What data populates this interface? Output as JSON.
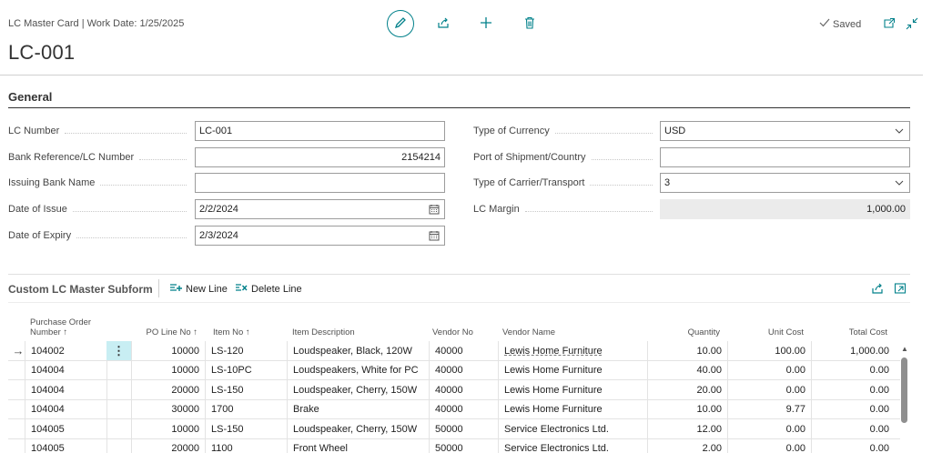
{
  "header": {
    "breadcrumb": "LC Master Card | Work Date: 1/25/2025",
    "record_title": "LC-001",
    "saved_label": "Saved"
  },
  "general": {
    "section_title": "General",
    "left_fields": [
      {
        "label": "LC Number",
        "value": "LC-001"
      },
      {
        "label": "Bank Reference/LC Number",
        "value": "2154214"
      },
      {
        "label": "Issuing Bank Name",
        "value": ""
      },
      {
        "label": "Date of Issue",
        "value": "2/2/2024"
      },
      {
        "label": "Date of Expiry",
        "value": "2/3/2024"
      }
    ],
    "right_fields": [
      {
        "label": "Type of Currency",
        "value": "USD"
      },
      {
        "label": "Port of Shipment/Country",
        "value": ""
      },
      {
        "label": "Type of Carrier/Transport",
        "value": "3"
      },
      {
        "label": "LC Margin",
        "value": "1,000.00"
      }
    ]
  },
  "subform": {
    "title": "Custom LC Master Subform",
    "new_line_label": "New Line",
    "delete_line_label": "Delete Line",
    "columns": {
      "po_number": "Purchase Order Number ↑",
      "po_line_no": "PO Line No ↑",
      "item_no": "Item No ↑",
      "item_description": "Item Description",
      "vendor_no": "Vendor No",
      "vendor_name": "Vendor Name",
      "quantity": "Quantity",
      "unit_cost": "Unit Cost",
      "total_cost": "Total Cost"
    },
    "rows": [
      {
        "po": "104002",
        "line": "10000",
        "item": "LS-120",
        "desc": "Loudspeaker, Black, 120W",
        "vendor_no": "40000",
        "vendor_name": "Lewis Home Furniture",
        "qty": "10.00",
        "unit": "100.00",
        "total": "1,000.00"
      },
      {
        "po": "104004",
        "line": "10000",
        "item": "LS-10PC",
        "desc": "Loudspeakers, White for PC",
        "vendor_no": "40000",
        "vendor_name": "Lewis Home Furniture",
        "qty": "40.00",
        "unit": "0.00",
        "total": "0.00"
      },
      {
        "po": "104004",
        "line": "20000",
        "item": "LS-150",
        "desc": "Loudspeaker, Cherry, 150W",
        "vendor_no": "40000",
        "vendor_name": "Lewis Home Furniture",
        "qty": "20.00",
        "unit": "0.00",
        "total": "0.00"
      },
      {
        "po": "104004",
        "line": "30000",
        "item": "1700",
        "desc": "Brake",
        "vendor_no": "40000",
        "vendor_name": "Lewis Home Furniture",
        "qty": "10.00",
        "unit": "9.77",
        "total": "0.00"
      },
      {
        "po": "104005",
        "line": "10000",
        "item": "LS-150",
        "desc": "Loudspeaker, Cherry, 150W",
        "vendor_no": "50000",
        "vendor_name": "Service Electronics Ltd.",
        "qty": "12.00",
        "unit": "0.00",
        "total": "0.00"
      },
      {
        "po": "104005",
        "line": "20000",
        "item": "1100",
        "desc": "Front Wheel",
        "vendor_no": "50000",
        "vendor_name": "Service Electronics Ltd.",
        "qty": "2.00",
        "unit": "0.00",
        "total": "0.00"
      }
    ]
  },
  "colors": {
    "accent": "#00808a",
    "readonly_bg": "#ebebeb",
    "selected_cell": "#c8eef3"
  },
  "icons": [
    "edit-icon",
    "share-icon",
    "add-icon",
    "delete-icon",
    "checkmark-icon",
    "popout-icon",
    "collapse-icon",
    "calendar-icon",
    "chevron-down-icon",
    "new-line-icon",
    "delete-line-icon",
    "row-arrow-icon",
    "expand-icon"
  ]
}
